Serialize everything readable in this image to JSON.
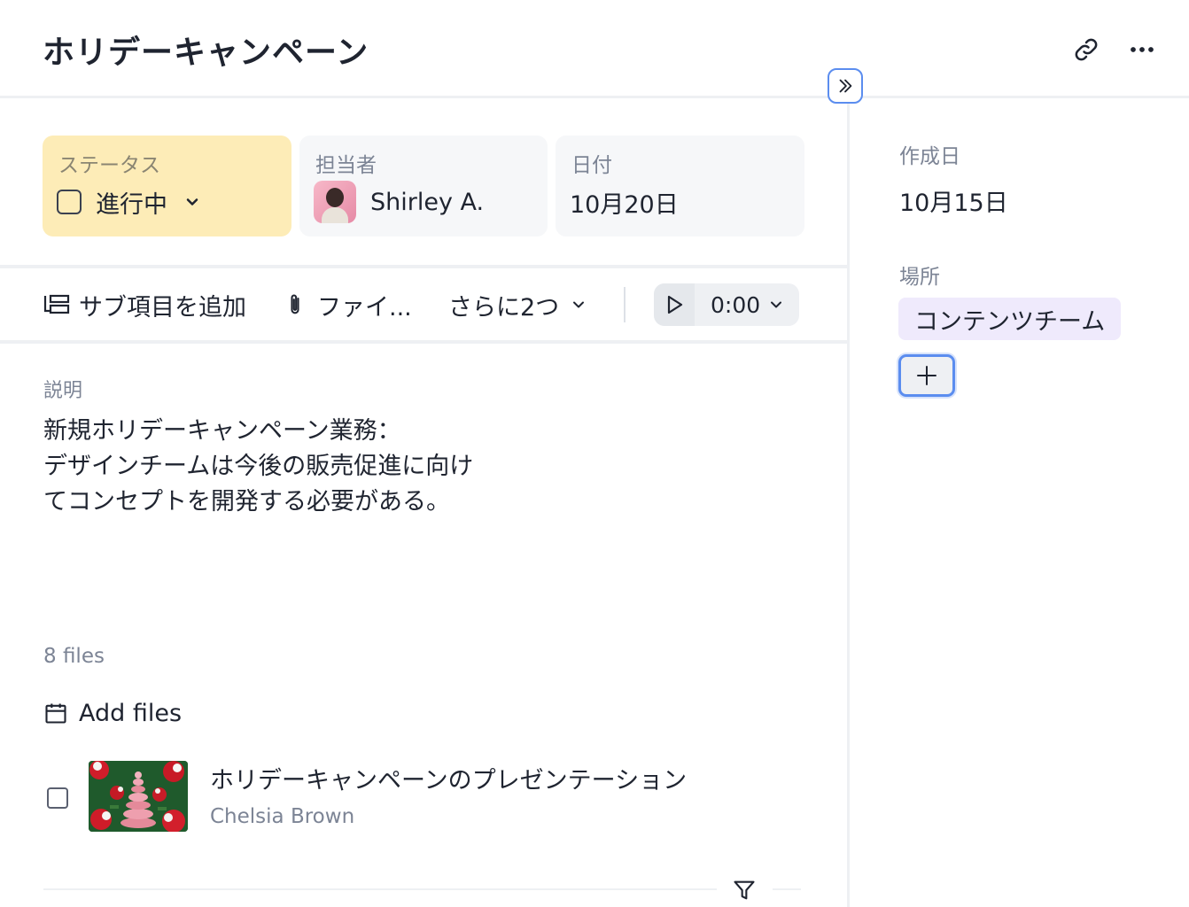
{
  "header": {
    "title": "ホリデーキャンペーン",
    "icons": [
      "link-icon",
      "more-icon"
    ]
  },
  "fields": {
    "status": {
      "label": "ステータス",
      "value": "進行中"
    },
    "assignee": {
      "label": "担当者",
      "value": "Shirley A."
    },
    "date": {
      "label": "日付",
      "value": "10月20日"
    }
  },
  "toolbar": {
    "add_subitem": "サブ項目を追加",
    "files": "ファイ...",
    "more": "さらに2つ",
    "timer": "0:00"
  },
  "description": {
    "label": "説明",
    "text": "新規ホリデーキャンペーン業務：\nデザインチームは今後の販売促進に向け\nてコンセプトを開発する必要がある。"
  },
  "files": {
    "count": "8 files",
    "add_label": "Add files",
    "items": [
      {
        "name": "ホリデーキャンペーンのプレゼンテーション",
        "author": "Chelsia Brown"
      }
    ]
  },
  "sidebar": {
    "created_label": "作成日",
    "created_value": "10月15日",
    "location_label": "場所",
    "location_tag": "コンテンツチーム"
  },
  "colors": {
    "status_bg": "#fdecb7",
    "tag_bg": "#efeafc",
    "accent": "#5b8def"
  }
}
